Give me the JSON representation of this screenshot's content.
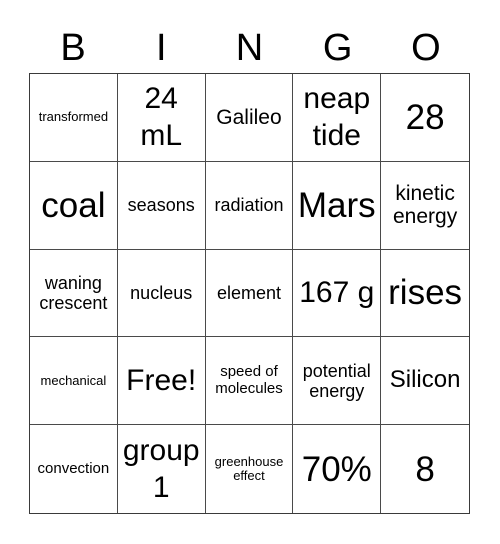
{
  "header": {
    "letters": [
      "B",
      "I",
      "N",
      "G",
      "O"
    ]
  },
  "cells": [
    {
      "text": "transformed",
      "size": "s-xs"
    },
    {
      "text": "24 mL",
      "size": "s-xl"
    },
    {
      "text": "Galileo",
      "size": "s-ml"
    },
    {
      "text": "neap tide",
      "size": "s-xl"
    },
    {
      "text": "28",
      "size": "s-xxl"
    },
    {
      "text": "coal",
      "size": "s-xxl"
    },
    {
      "text": "seasons",
      "size": "s-md"
    },
    {
      "text": "radiation",
      "size": "s-md"
    },
    {
      "text": "Mars",
      "size": "s-xxl"
    },
    {
      "text": "kinetic energy",
      "size": "s-ml"
    },
    {
      "text": "waning crescent",
      "size": "s-md"
    },
    {
      "text": "nucleus",
      "size": "s-md"
    },
    {
      "text": "element",
      "size": "s-md"
    },
    {
      "text": "167 g",
      "size": "s-xl"
    },
    {
      "text": "rises",
      "size": "s-xxl"
    },
    {
      "text": "mechanical",
      "size": "s-xs"
    },
    {
      "text": "Free!",
      "size": "s-xl"
    },
    {
      "text": "speed of molecules",
      "size": "s-sm"
    },
    {
      "text": "potential energy",
      "size": "s-md"
    },
    {
      "text": "Silicon",
      "size": "s-lg"
    },
    {
      "text": "convection",
      "size": "s-sm"
    },
    {
      "text": "group 1",
      "size": "s-xl"
    },
    {
      "text": "greenhouse effect",
      "size": "s-xs"
    },
    {
      "text": "70%",
      "size": "s-xxl"
    },
    {
      "text": "8",
      "size": "s-xxl"
    }
  ]
}
